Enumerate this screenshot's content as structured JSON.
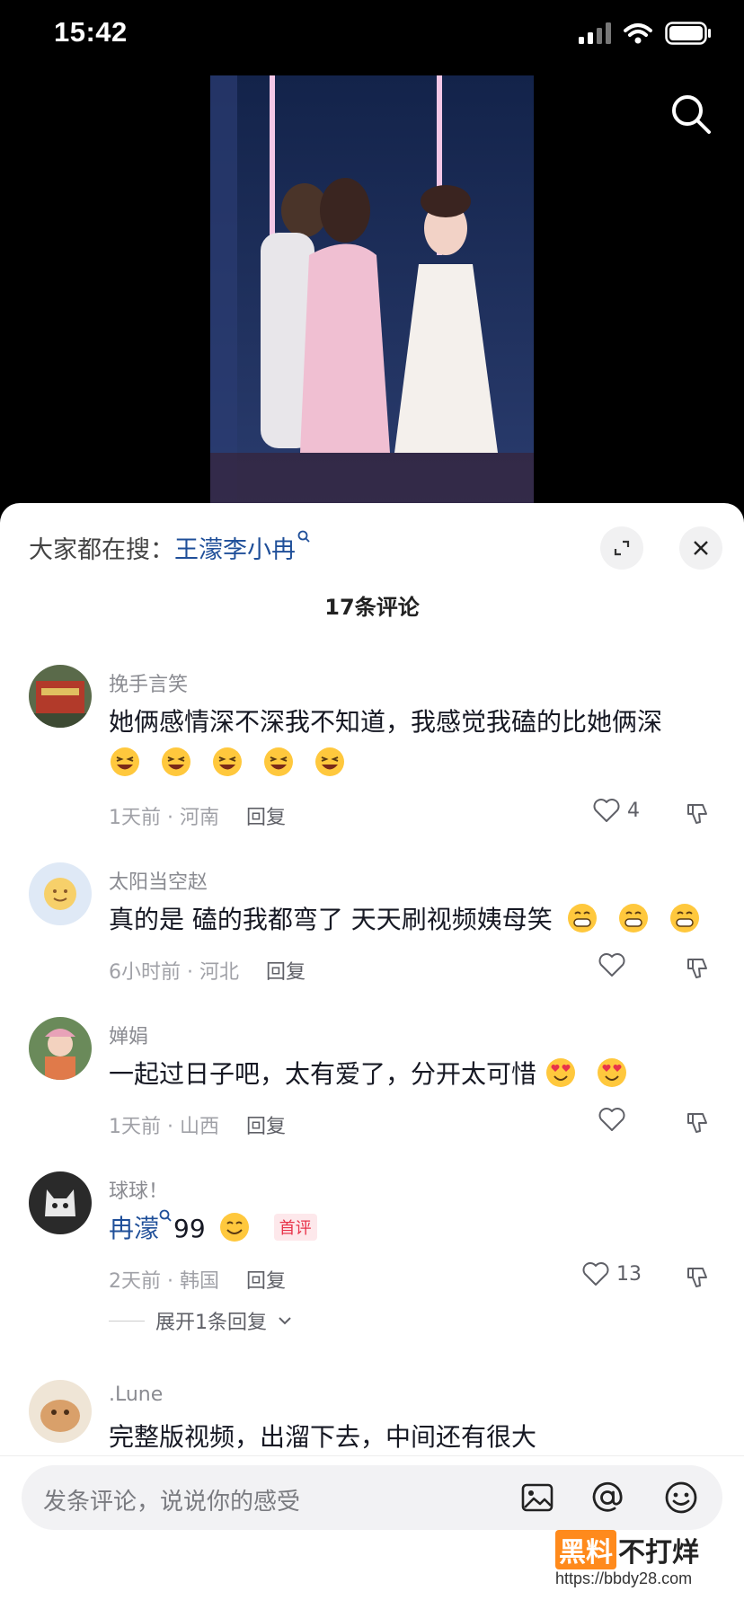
{
  "status": {
    "time": "15:42"
  },
  "hot_search": {
    "prefix": "大家都在搜：",
    "term": "王濛李小冉"
  },
  "comment_count": "17条评论",
  "comments": [
    {
      "user": "挽手言笑",
      "text": "她俩感情深不深我不知道，我感觉我磕的比她俩深",
      "emoji": "grinning-squint-face",
      "emoji_count": 5,
      "time_location": "1天前 · 河南",
      "reply": "回复",
      "likes": "4"
    },
    {
      "user": "太阳当空赵",
      "text": "真的是  磕的我都弯了  天天刷视频姨母笑",
      "emoji": "grinning-teeth-face",
      "emoji_count": 3,
      "time_location": "6小时前 · 河北",
      "reply": "回复",
      "likes": ""
    },
    {
      "user": "婵娟",
      "text": "一起过日子吧，太有爱了，分开太可惜",
      "emoji": "heart-eyes-face",
      "emoji_count": 2,
      "time_location": "1天前 · 山西",
      "reply": "回复",
      "likes": ""
    },
    {
      "user": "球球！",
      "link": "冉濛",
      "text": "99",
      "emoji": "smiling-face",
      "emoji_count": 1,
      "tag": "首评",
      "time_location": "2天前 · 韩国",
      "reply": "回复",
      "likes": "13",
      "expand": "展开1条回复"
    },
    {
      "user": ".Lune",
      "text": "完整版视频，出溜下去，中间还有很大"
    }
  ],
  "input": {
    "placeholder": "发条评论，说说你的感受"
  },
  "watermark": {
    "mark": "黑料",
    "rest": "不打烊",
    "url": "https://bbdy28.com"
  }
}
